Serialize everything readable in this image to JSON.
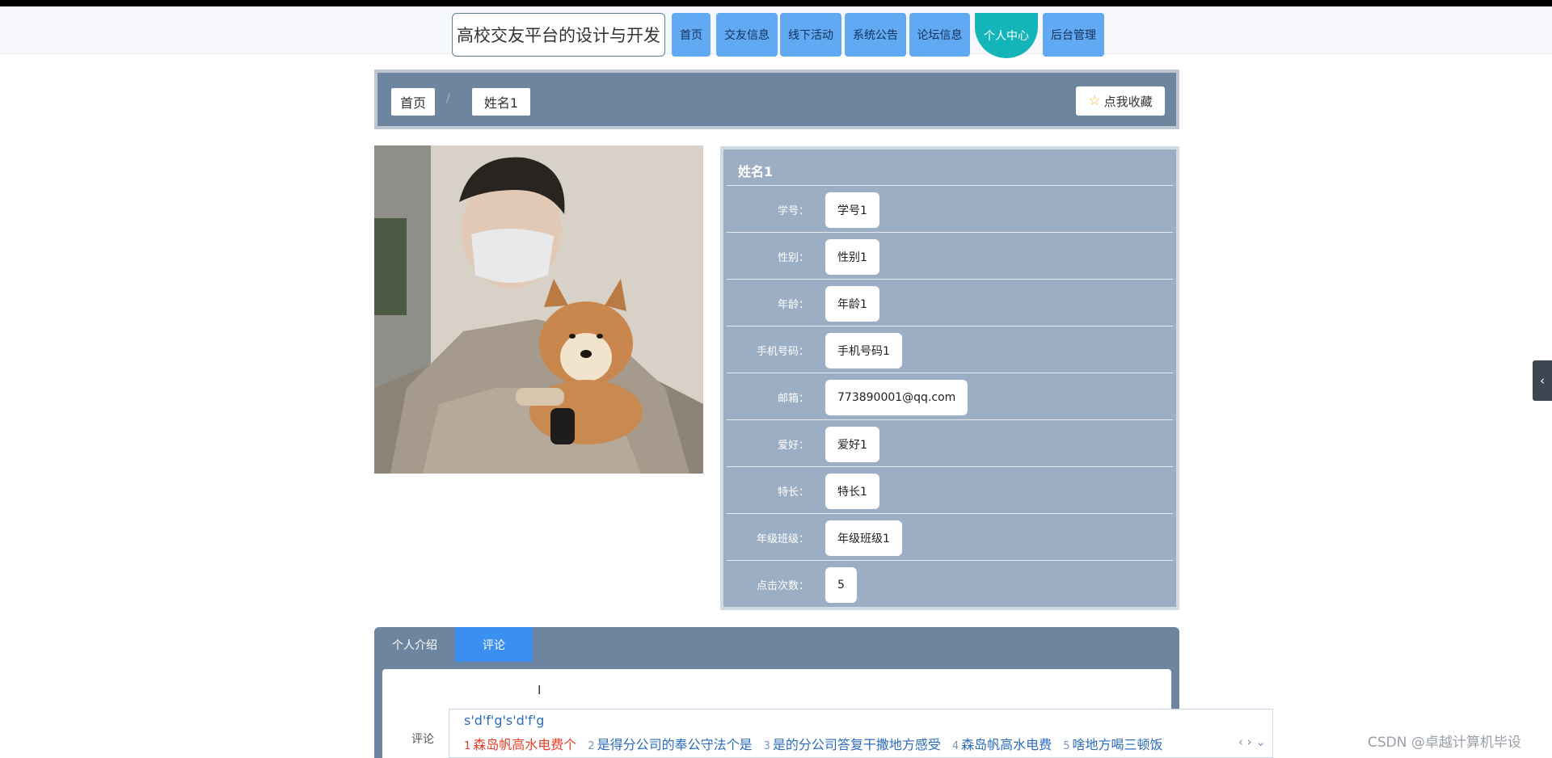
{
  "site": {
    "title": "高校交友平台的设计与开发"
  },
  "nav": {
    "items": [
      "首页",
      "交友信息",
      "线下活动",
      "系统公告",
      "论坛信息",
      "个人中心",
      "后台管理"
    ],
    "active_index": 5
  },
  "breadcrumb": {
    "home": "首页",
    "current": "姓名1",
    "separator": "/"
  },
  "favorite": {
    "label": "点我收藏",
    "icon": "star-icon"
  },
  "profile": {
    "name": "姓名1",
    "fields": [
      {
        "label": "学号：",
        "value": "学号1"
      },
      {
        "label": "性别：",
        "value": "性别1"
      },
      {
        "label": "年龄：",
        "value": "年龄1"
      },
      {
        "label": "手机号码：",
        "value": "手机号码1"
      },
      {
        "label": "邮箱：",
        "value": "773890001@qq.com"
      },
      {
        "label": "爱好：",
        "value": "爱好1"
      },
      {
        "label": "特长：",
        "value": "特长1"
      },
      {
        "label": "年级班级：",
        "value": "年级班级1"
      },
      {
        "label": "点击次数：",
        "value": "5"
      }
    ]
  },
  "tabs": {
    "items": [
      "个人介绍",
      "评论"
    ],
    "active_index": 1
  },
  "comment": {
    "label": "评论",
    "value": "sdfgsdfg"
  },
  "ime": {
    "composing": "s'd'f'g's'd'f'g",
    "candidates": [
      "森岛帆高水电费个",
      "是得分公司的奉公守法个是",
      "是的分公司答复干撒地方感受",
      "森岛帆高水电费",
      "啥地方喝三顿饭"
    ]
  },
  "watermark": "CSDN @卓越计算机毕设",
  "colors": {
    "nav": "#61a9f3",
    "active": "#13b5b8",
    "panel": "#6e859f",
    "info": "#9caec4",
    "tab_active": "#3b8ff0"
  }
}
